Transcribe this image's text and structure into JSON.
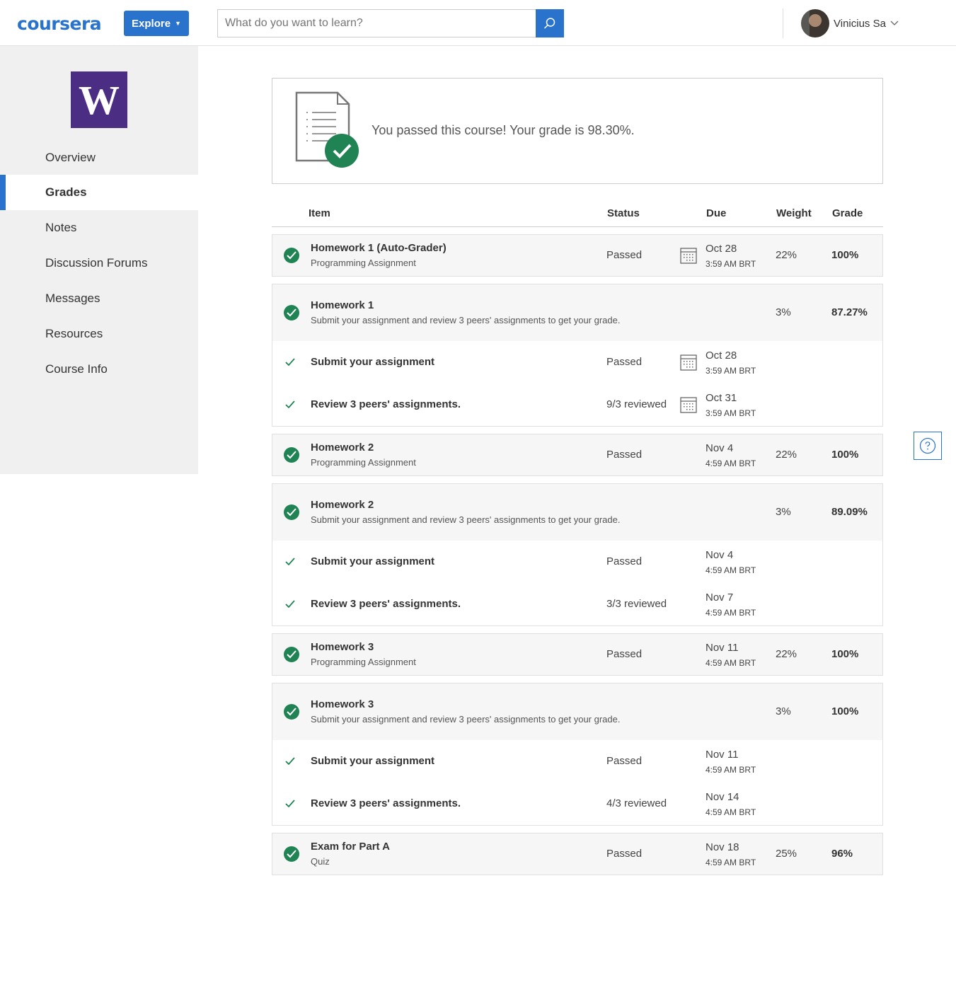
{
  "header": {
    "logo": "coursera",
    "explore_label": "Explore",
    "search_placeholder": "What do you want to learn?",
    "user_name": "Vinicius Sa"
  },
  "sidebar": {
    "logo_letter": "W",
    "items": [
      {
        "label": "Overview"
      },
      {
        "label": "Grades"
      },
      {
        "label": "Notes"
      },
      {
        "label": "Discussion Forums"
      },
      {
        "label": "Messages"
      },
      {
        "label": "Resources"
      },
      {
        "label": "Course Info"
      }
    ]
  },
  "banner": {
    "text": "You passed this course! Your grade is 98.30%."
  },
  "table": {
    "headers": {
      "item": "Item",
      "status": "Status",
      "due": "Due",
      "weight": "Weight",
      "grade": "Grade"
    },
    "rows": [
      {
        "title": "Homework 1 (Auto-Grader)",
        "sub": "Programming Assignment",
        "status": "Passed",
        "due_date": "Oct 28",
        "due_time": "3:59 AM BRT",
        "weight": "22%",
        "grade": "100%"
      },
      {
        "title": "Homework 1",
        "sub": "Submit your assignment and review 3 peers' assignments to get your grade.",
        "weight": "3%",
        "grade": "87.27%",
        "subitems": [
          {
            "title": "Submit your assignment",
            "status": "Passed",
            "due_date": "Oct 28",
            "due_time": "3:59 AM BRT"
          },
          {
            "title": "Review 3 peers' assignments.",
            "status": "9/3 reviewed",
            "due_date": "Oct 31",
            "due_time": "3:59 AM BRT"
          }
        ]
      },
      {
        "title": "Homework 2",
        "sub": "Programming Assignment",
        "status": "Passed",
        "due_date": "Nov 4",
        "due_time": "4:59 AM BRT",
        "weight": "22%",
        "grade": "100%"
      },
      {
        "title": "Homework 2",
        "sub": "Submit your assignment and review 3 peers' assignments to get your grade.",
        "weight": "3%",
        "grade": "89.09%",
        "subitems": [
          {
            "title": "Submit your assignment",
            "status": "Passed",
            "due_date": "Nov 4",
            "due_time": "4:59 AM BRT"
          },
          {
            "title": "Review 3 peers' assignments.",
            "status": "3/3 reviewed",
            "due_date": "Nov 7",
            "due_time": "4:59 AM BRT"
          }
        ]
      },
      {
        "title": "Homework 3",
        "sub": "Programming Assignment",
        "status": "Passed",
        "due_date": "Nov 11",
        "due_time": "4:59 AM BRT",
        "weight": "22%",
        "grade": "100%"
      },
      {
        "title": "Homework 3",
        "sub": "Submit your assignment and review 3 peers' assignments to get your grade.",
        "weight": "3%",
        "grade": "100%",
        "subitems": [
          {
            "title": "Submit your assignment",
            "status": "Passed",
            "due_date": "Nov 11",
            "due_time": "4:59 AM BRT"
          },
          {
            "title": "Review 3 peers' assignments.",
            "status": "4/3 reviewed",
            "due_date": "Nov 14",
            "due_time": "4:59 AM BRT"
          }
        ]
      },
      {
        "title": "Exam for Part A",
        "sub": "Quiz",
        "status": "Passed",
        "due_date": "Nov 18",
        "due_time": "4:59 AM BRT",
        "weight": "25%",
        "grade": "96%"
      }
    ]
  },
  "colors": {
    "accent": "#2a73cc",
    "success": "#1f8354",
    "university": "#4b2e83"
  }
}
